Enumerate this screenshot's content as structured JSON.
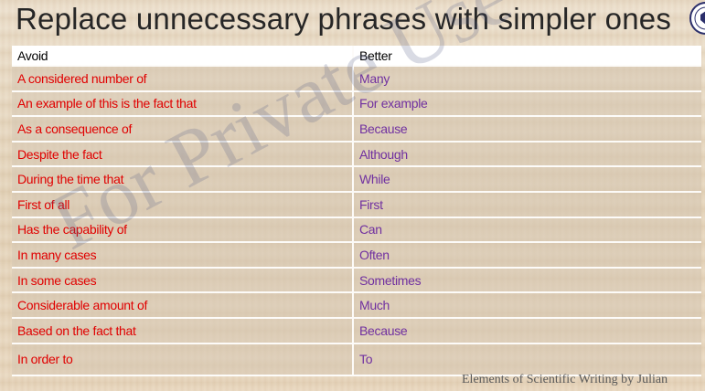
{
  "title": "Replace unnecessary phrases with simpler ones",
  "table": {
    "headers": [
      "Avoid",
      "Better"
    ],
    "rows": [
      {
        "avoid": "A considered number of",
        "better": "Many"
      },
      {
        "avoid": "An example of this is the fact that",
        "better": "For example"
      },
      {
        "avoid": "As a consequence of",
        "better": "Because"
      },
      {
        "avoid": "Despite the fact",
        "better": "Although"
      },
      {
        "avoid": "During the time that",
        "better": "While"
      },
      {
        "avoid": "First of all",
        "better": "First"
      },
      {
        "avoid": "Has the capability of",
        "better": "Can"
      },
      {
        "avoid": "In many cases",
        "better": "Often"
      },
      {
        "avoid": "In some cases",
        "better": "Sometimes"
      },
      {
        "avoid": "Considerable amount of",
        "better": "Much"
      },
      {
        "avoid": "Based on the fact that",
        "better": "Because"
      },
      {
        "avoid": "In order to",
        "better": "To"
      }
    ]
  },
  "watermark": "For Private Use Only",
  "footer": "Elements of Scientific Writing by Julian",
  "colors": {
    "avoid": "#e00000",
    "better": "#7030a0"
  }
}
